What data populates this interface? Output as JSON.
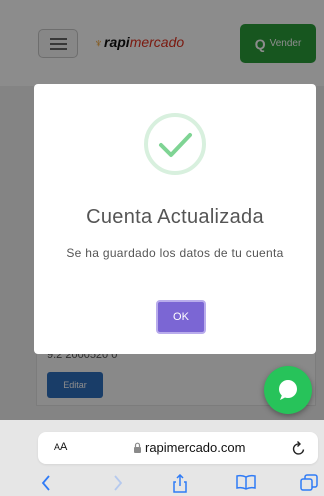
{
  "header": {
    "logo": {
      "brand_part1": "rapi",
      "brand_part2": "mercado"
    },
    "sell_button": {
      "icon_letter": "Q",
      "label": "Vender"
    }
  },
  "profile_card": {
    "phone_partial": "9.2 2000520 0",
    "edit_label": "Editar"
  },
  "modal": {
    "title": "Cuenta Actualizada",
    "message": "Se ha guardado los datos de tu cuenta",
    "ok_label": "OK",
    "accent_color": "#7b66d4",
    "success_color": "#7fd494"
  },
  "browser": {
    "text_size_label_small": "A",
    "text_size_label_large": "A",
    "url": "rapimercado.com"
  },
  "colors": {
    "sell_green": "#2a9d3a",
    "chat_green": "#27c35a",
    "edit_blue": "#2f6fbd",
    "ios_blue": "#2f7bf6"
  }
}
